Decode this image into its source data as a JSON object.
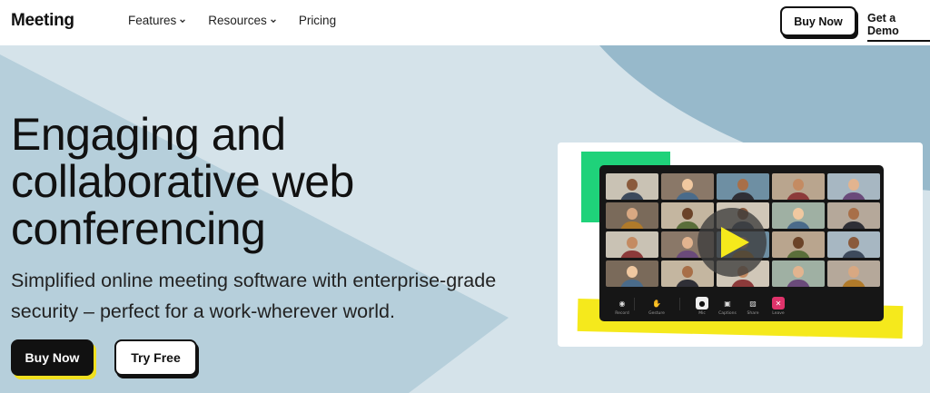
{
  "header": {
    "logo": "Meeting",
    "nav": [
      {
        "label": "Features",
        "has_dropdown": true
      },
      {
        "label": "Resources",
        "has_dropdown": true
      },
      {
        "label": "Pricing",
        "has_dropdown": false
      }
    ],
    "buy_now": "Buy Now",
    "get_demo": "Get a Demo"
  },
  "hero": {
    "headline": "Engaging and collaborative web conferencing",
    "subtitle": "Simplified online meeting software with enterprise-grade security – perfect for a work-wherever world.",
    "buy_now": "Buy Now",
    "try_free": "Try Free"
  },
  "mockup": {
    "toolbar": [
      {
        "label": "Record",
        "icon": "record-icon"
      },
      {
        "label": "Gesture",
        "icon": "hand-icon"
      },
      {
        "label": "Mic",
        "icon": "mic-icon"
      },
      {
        "label": "Captions",
        "icon": "camera-icon"
      },
      {
        "label": "Share",
        "icon": "share-icon"
      },
      {
        "label": "Leave",
        "icon": "close-icon"
      }
    ],
    "play_icon": "play-icon"
  },
  "colors": {
    "hero_bg": "#d5e3ea",
    "hero_shape": "#b4cdd9",
    "accent_green": "#1fd27a",
    "accent_yellow": "#f5e91c",
    "dark": "#111111"
  }
}
